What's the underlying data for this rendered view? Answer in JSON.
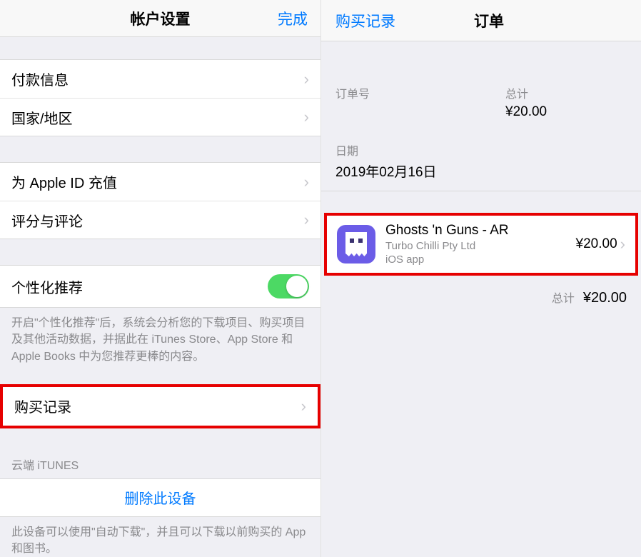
{
  "left": {
    "header": {
      "title": "帐户设置",
      "done": "完成"
    },
    "group1": {
      "payment": "付款信息",
      "country": "国家/地区"
    },
    "group2": {
      "topup": "为 Apple ID 充值",
      "ratings": "评分与评论"
    },
    "personalized": {
      "label": "个性化推荐",
      "footer": "开启\"个性化推荐\"后，系统会分析您的下载项目、购买项目及其他活动数据，并据此在 iTunes Store、App Store 和 Apple Books 中为您推荐更棒的内容。"
    },
    "purchase_history": "购买记录",
    "cloud": {
      "header": "云端 iTUNES",
      "remove": "删除此设备",
      "footer": "此设备可以使用\"自动下载\"，并且可以下载以前购买的 App 和图书。"
    }
  },
  "right": {
    "header": {
      "back": "购买记录",
      "title": "订单"
    },
    "meta": {
      "order_no_label": "订单号",
      "total_label": "总计",
      "total_value": "¥20.00",
      "date_label": "日期",
      "date_value": "2019年02月16日"
    },
    "item": {
      "title": "Ghosts 'n Guns - AR",
      "developer": "Turbo Chilli Pty Ltd",
      "kind": "iOS app",
      "price": "¥20.00"
    },
    "totals": {
      "label": "总计",
      "value": "¥20.00"
    }
  }
}
